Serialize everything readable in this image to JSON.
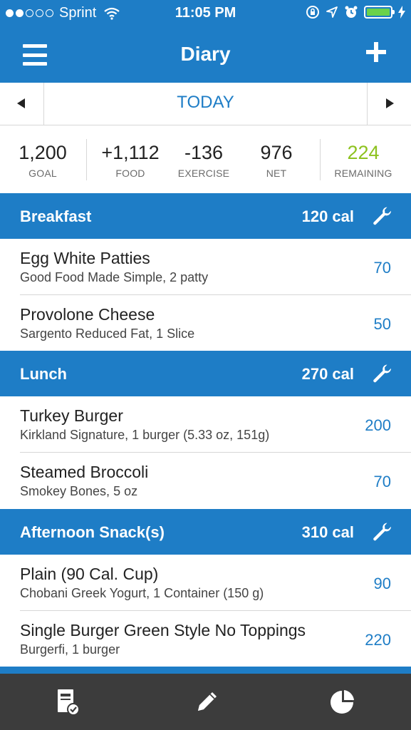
{
  "status_bar": {
    "carrier": "Sprint",
    "time": "11:05 PM",
    "signal_bars_filled": 2,
    "signal_bars_total": 5,
    "battery_color": "#6ad24a"
  },
  "nav": {
    "title": "Diary",
    "menu_icon": "hamburger-menu-icon",
    "add_icon": "plus-icon"
  },
  "date_bar": {
    "date_label": "TODAY"
  },
  "summary": {
    "goal": {
      "value": "1,200",
      "label": "GOAL"
    },
    "food": {
      "value": "+1,112",
      "label": "FOOD"
    },
    "exercise": {
      "value": "-136",
      "label": "EXERCISE"
    },
    "net": {
      "value": "976",
      "label": "NET"
    },
    "remaining": {
      "value": "224",
      "label": "REMAINING",
      "color": "#8dc21f"
    }
  },
  "sections": [
    {
      "name": "Breakfast",
      "calories": "120 cal",
      "entries": [
        {
          "food": "Egg White Patties",
          "description": "Good Food Made Simple, 2 patty",
          "calories": "70"
        },
        {
          "food": "Provolone Cheese",
          "description": "Sargento Reduced Fat, 1 Slice",
          "calories": "50"
        }
      ]
    },
    {
      "name": "Lunch",
      "calories": "270 cal",
      "entries": [
        {
          "food": "Turkey Burger",
          "description": "Kirkland Signature, 1 burger (5.33 oz, 151g)",
          "calories": "200"
        },
        {
          "food": "Steamed Broccoli",
          "description": "Smokey Bones, 5 oz",
          "calories": "70"
        }
      ]
    },
    {
      "name": "Afternoon Snack(s)",
      "calories": "310 cal",
      "entries": [
        {
          "food": "Plain (90 Cal. Cup)",
          "description": "Chobani Greek Yogurt, 1 Container (150 g)",
          "calories": "90"
        },
        {
          "food": "Single Burger Green Style No Toppings",
          "description": "Burgerfi, 1 burger",
          "calories": "220"
        }
      ]
    }
  ],
  "tab_bar": {
    "tabs": [
      "diary-icon",
      "pencil-icon",
      "pie-chart-icon"
    ]
  },
  "colors": {
    "brand_blue": "#1e7dc6",
    "tab_bar": "#3c3c3c"
  }
}
